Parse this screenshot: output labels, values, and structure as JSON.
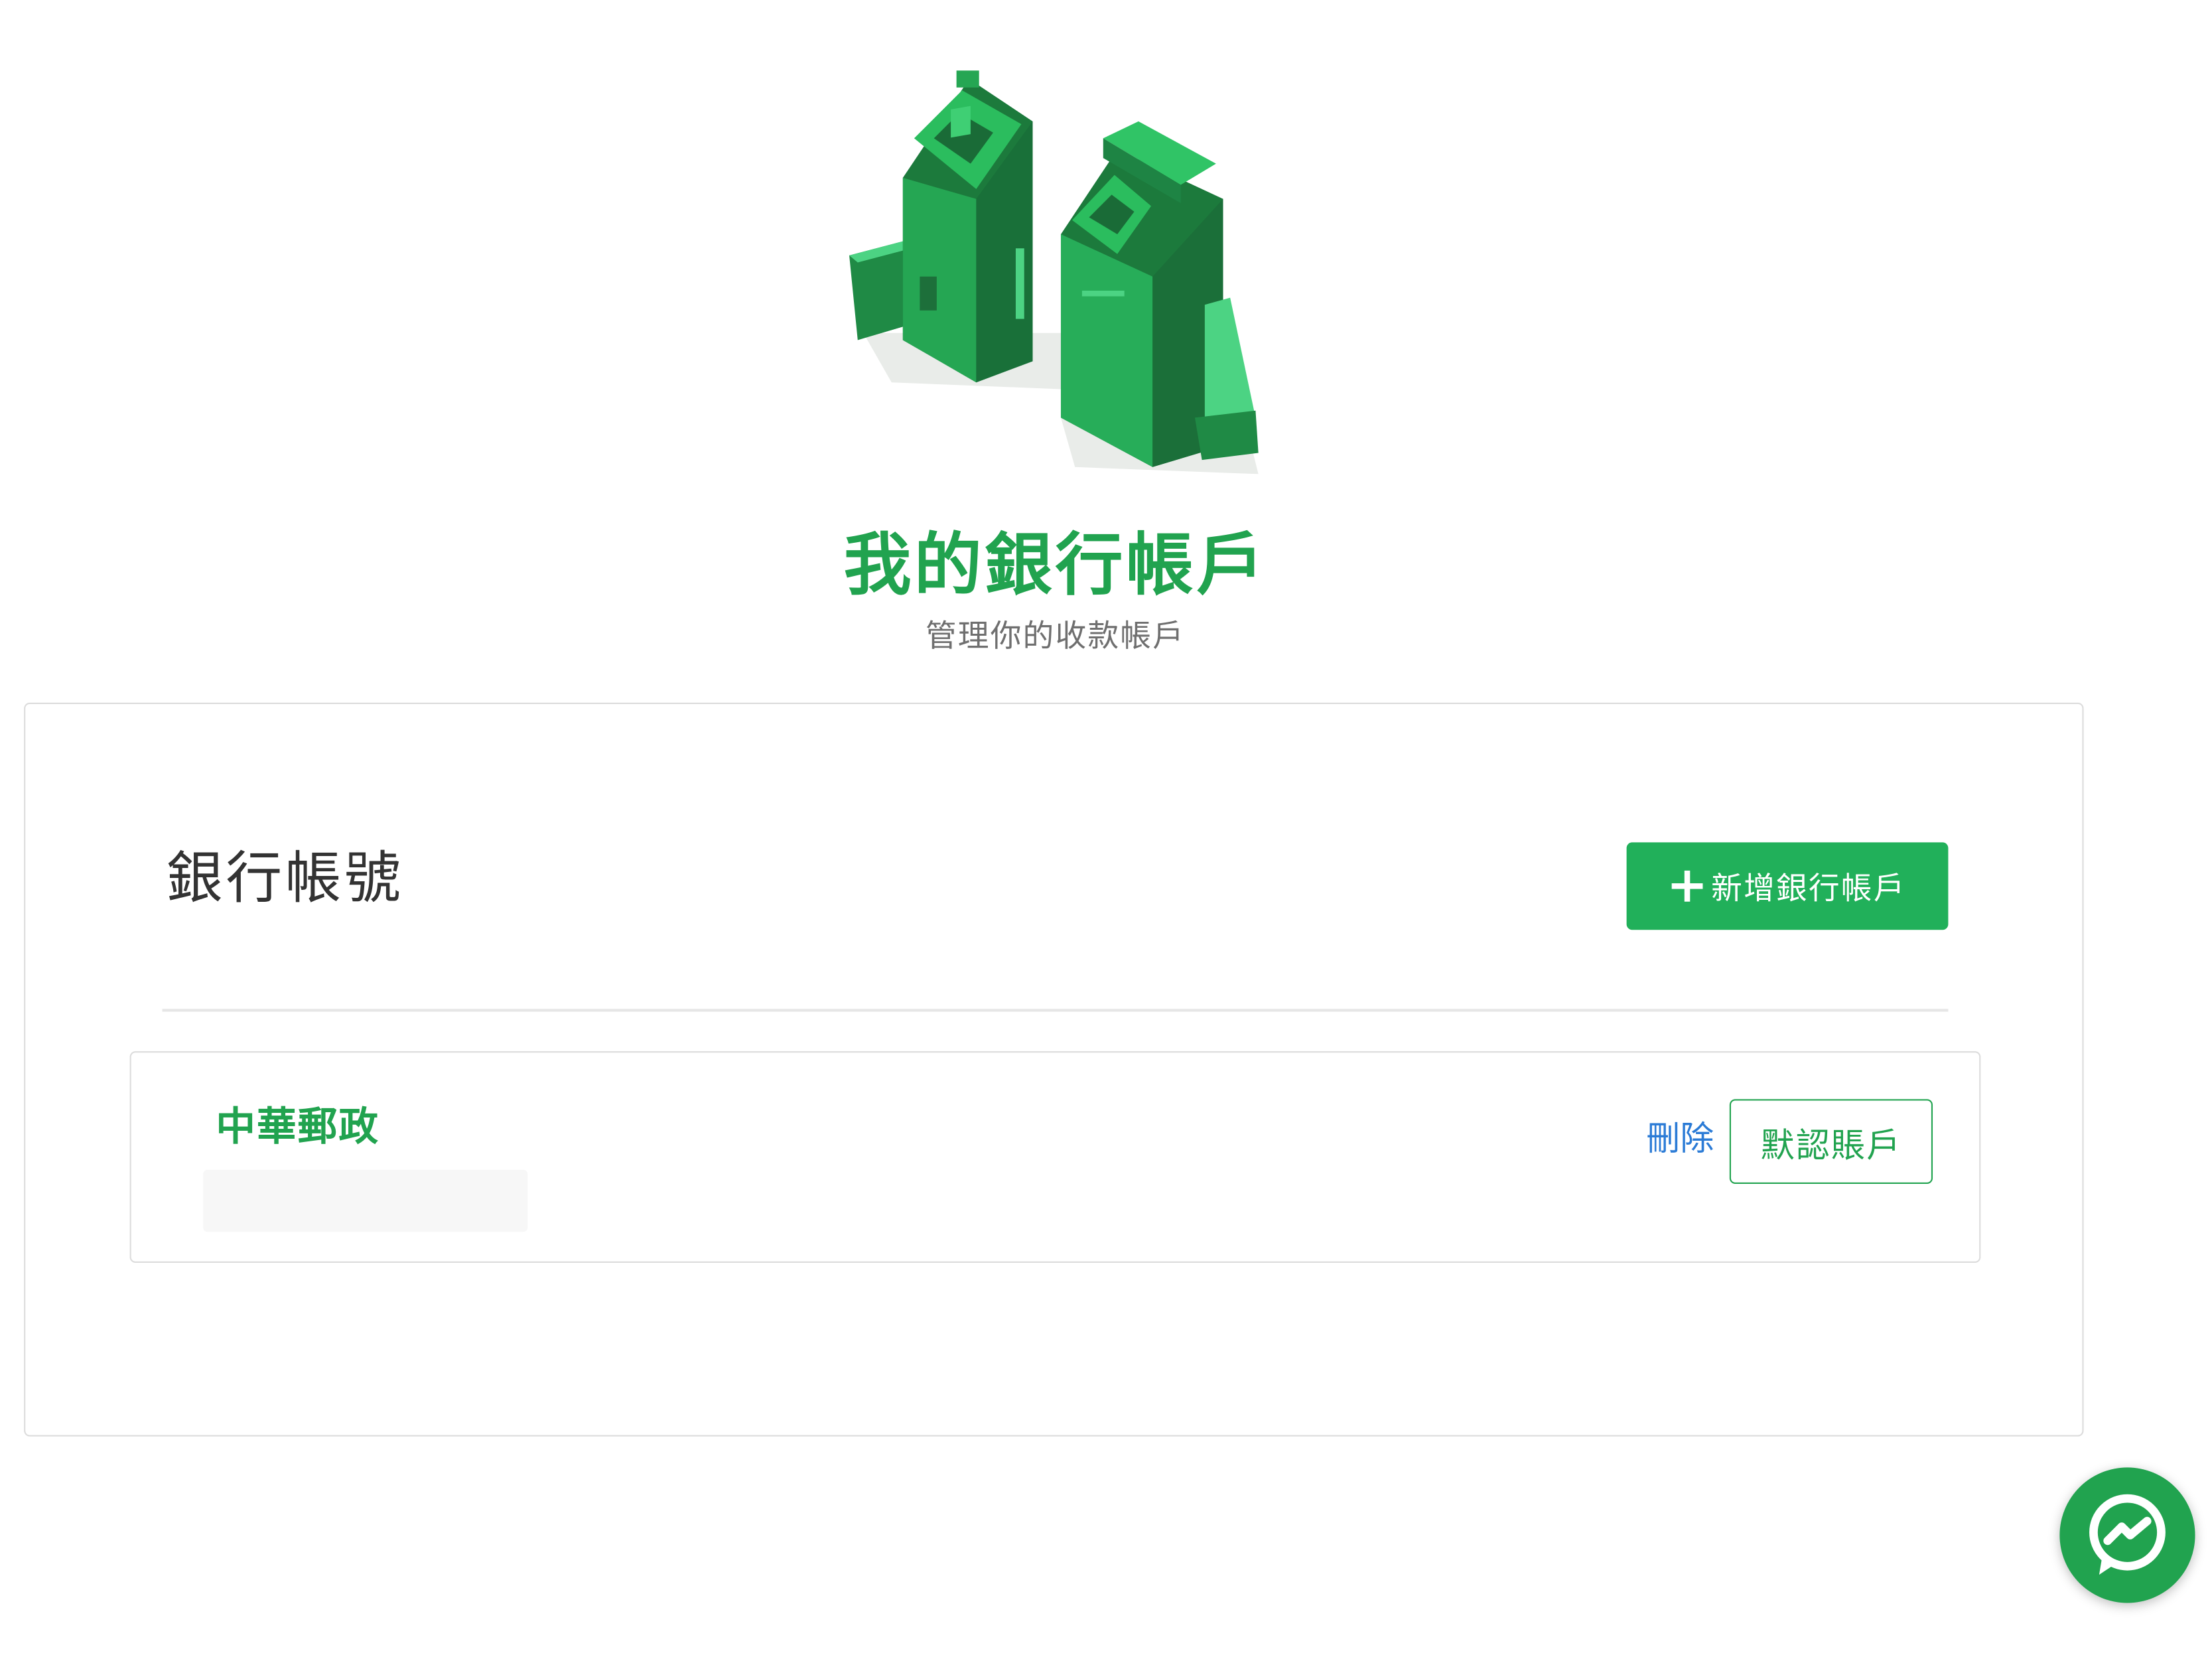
{
  "header": {
    "title": "我的銀行帳戶",
    "subtitle": "管理你的收款帳戶"
  },
  "section": {
    "heading": "銀行帳號",
    "add_button_label": "新增銀行帳戶"
  },
  "accounts": [
    {
      "bank_name": "中華郵政",
      "delete_label": "刪除",
      "default_label": "默認賬戶"
    }
  ],
  "colors": {
    "brand_green": "#21a34f",
    "button_green": "#21b05a",
    "link_blue": "#2b7bd6"
  },
  "icons": {
    "add_button": "plus-icon",
    "hero": "atm-machines-illustration",
    "fab": "messenger-icon"
  }
}
